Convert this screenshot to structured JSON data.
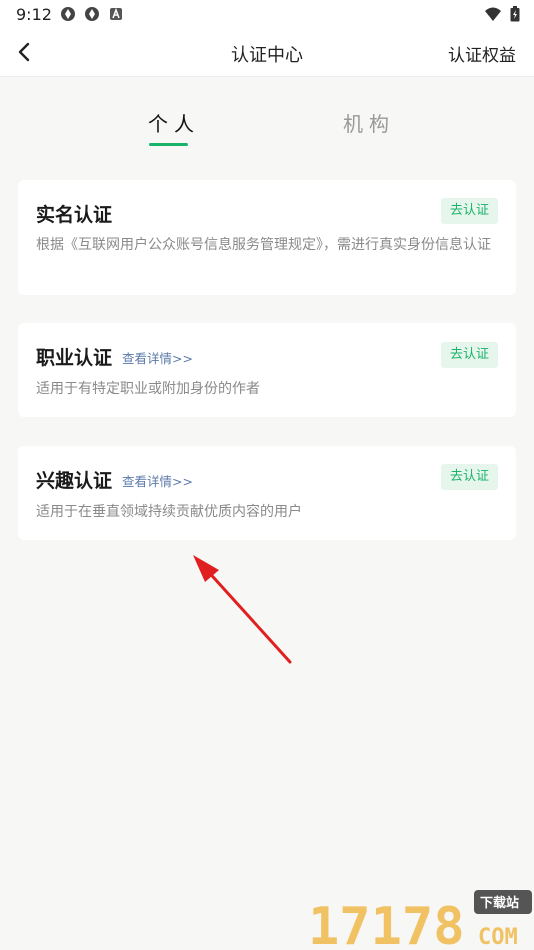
{
  "status": {
    "time": "9:12"
  },
  "header": {
    "title": "认证中心",
    "benefits_label": "认证权益"
  },
  "tabs": [
    {
      "label": "个人"
    },
    {
      "label": "机构"
    }
  ],
  "cards": [
    {
      "title": "实名认证",
      "button": "去认证",
      "desc": "根据《互联网用户公众账号信息服务管理规定》，需进行真实身份信息认证"
    },
    {
      "title": "职业认证",
      "detail": "查看详情>>",
      "button": "去认证",
      "desc": "适用于有特定职业或附加身份的作者"
    },
    {
      "title": "兴趣认证",
      "detail": "查看详情>>",
      "button": "去认证",
      "desc": "适用于在垂直领域持续贡献优质内容的用户"
    }
  ],
  "colors": {
    "accent": "#1ab36a",
    "link": "#5b7aa8",
    "arrow": "#e02020"
  },
  "watermark": {
    "main": "17178",
    "badge": "下载站",
    "domain": "COM"
  }
}
